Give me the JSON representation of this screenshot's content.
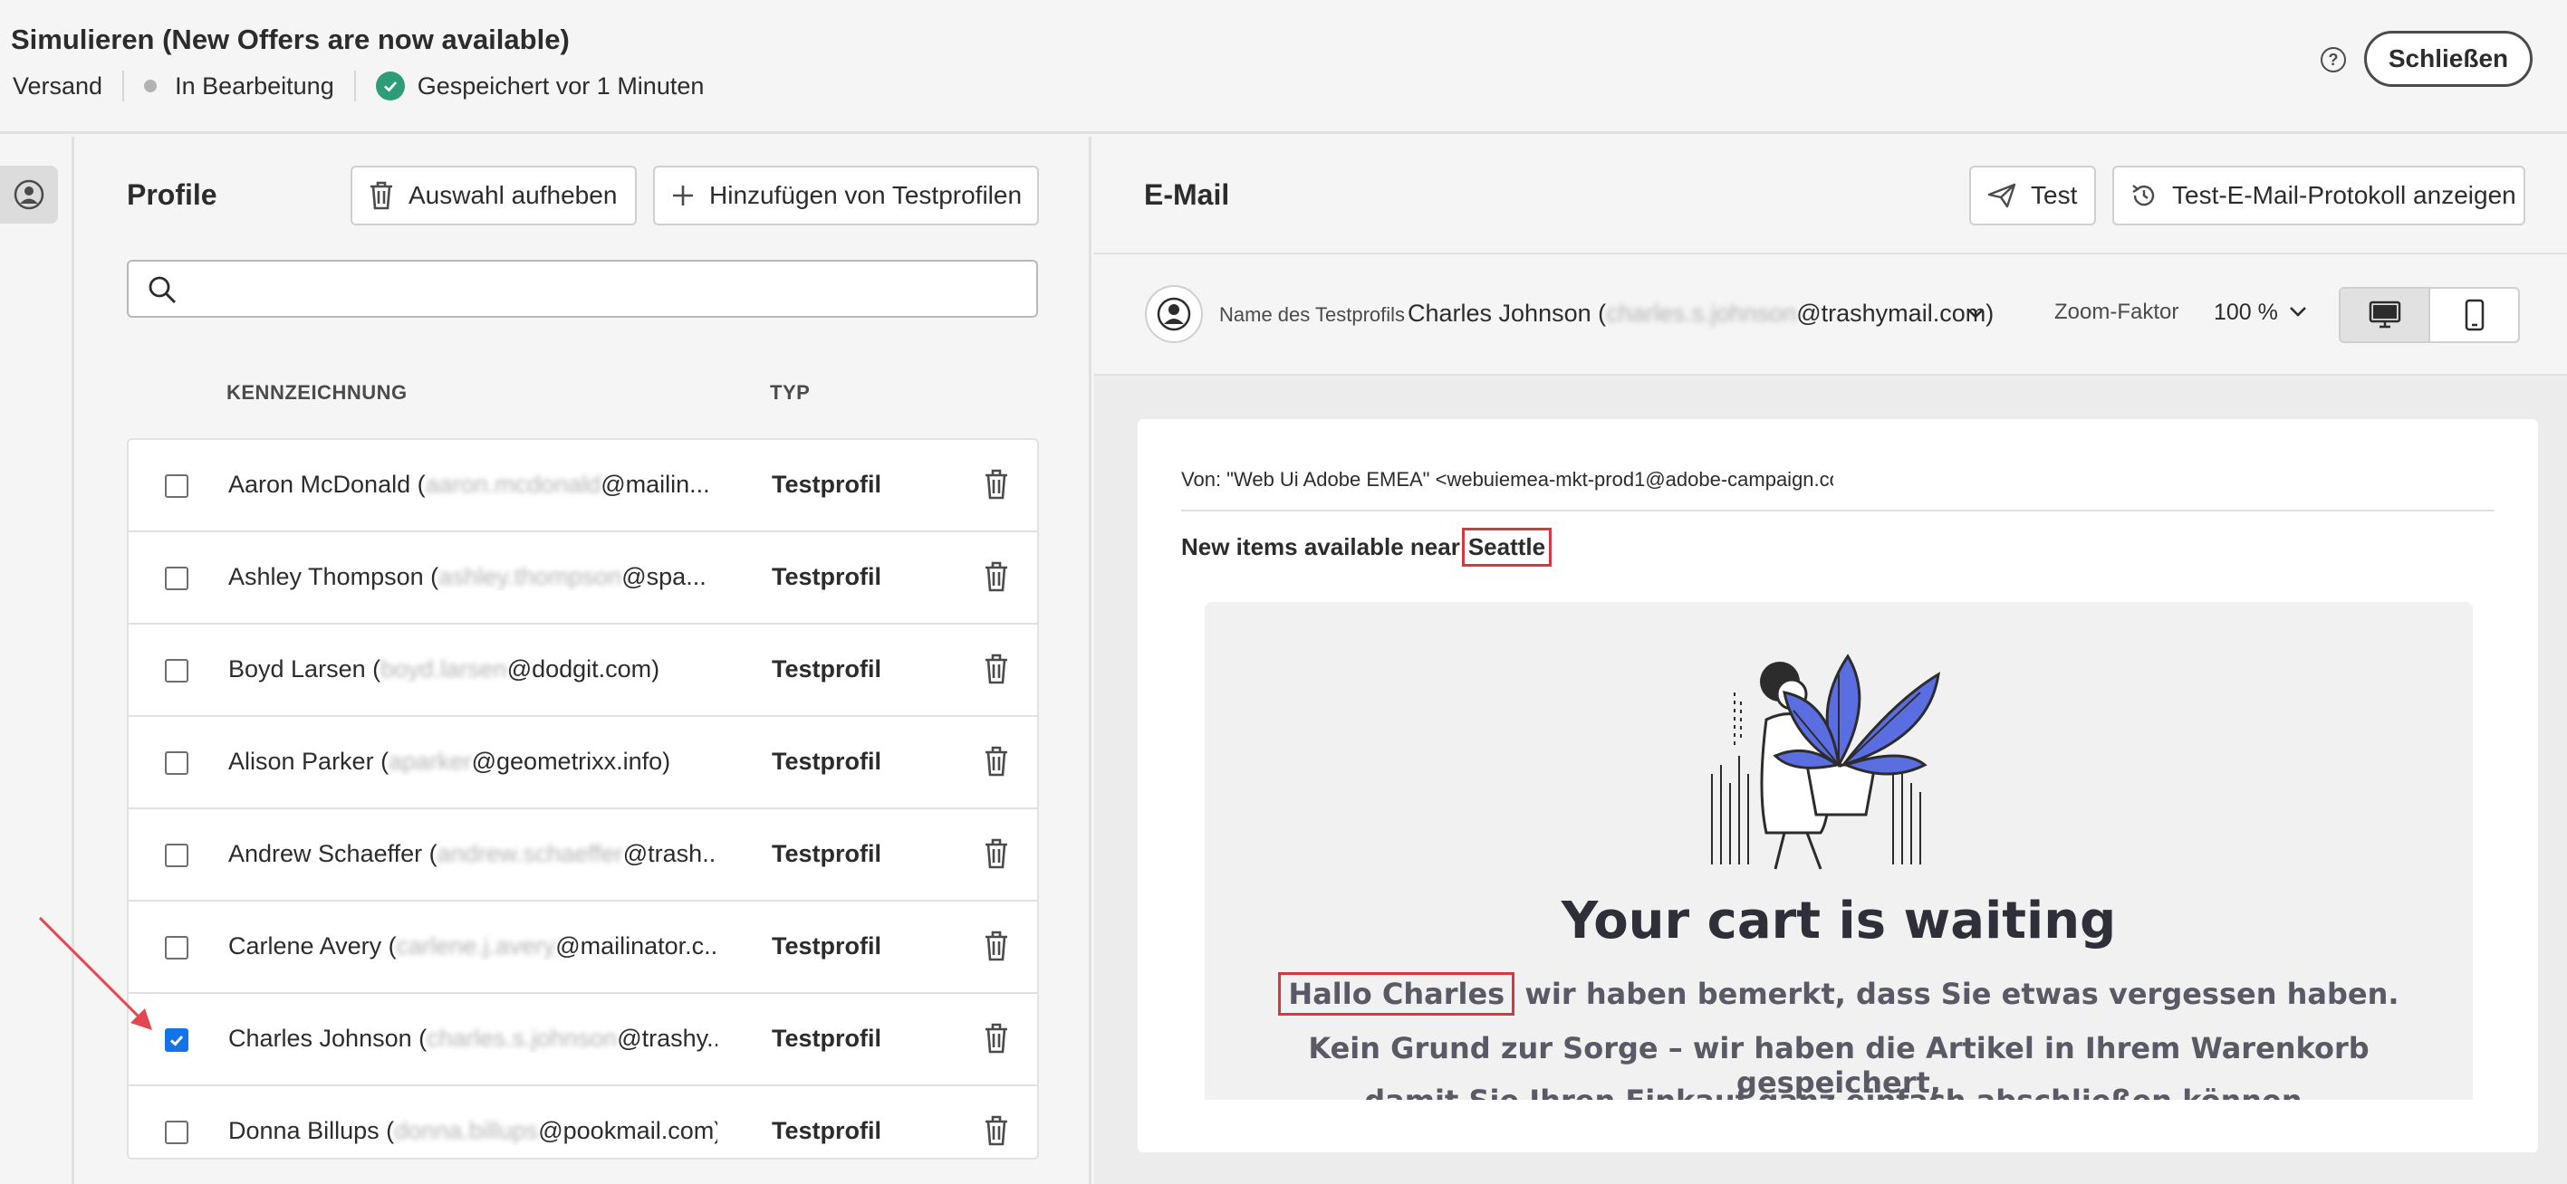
{
  "header": {
    "title": "Simulieren (New Offers are now available)",
    "breadcrumb_delivery": "Versand",
    "status": "In Bearbeitung",
    "saved": "Gespeichert vor 1 Minuten",
    "close_label": "Schließen",
    "help_glyph": "?"
  },
  "profiles": {
    "title": "Profile",
    "clear_selection_label": "Auswahl aufheben",
    "add_test_profiles_label": "Hinzufügen von Testprofilen",
    "search_placeholder": "",
    "col_label": "KENNZEICHNUNG",
    "col_type": "TYP",
    "rows": [
      {
        "name_start": "Aaron McDonald (",
        "name_blur": "aaron.mcdonald",
        "name_end": "@mailin...",
        "type": "Testprofil",
        "checked": false
      },
      {
        "name_start": "Ashley Thompson (",
        "name_blur": "ashley.thompson",
        "name_end": "@spa...",
        "type": "Testprofil",
        "checked": false
      },
      {
        "name_start": "Boyd Larsen (",
        "name_blur": "boyd.larsen",
        "name_end": "@dodgit.com)",
        "type": "Testprofil",
        "checked": false
      },
      {
        "name_start": "Alison Parker (",
        "name_blur": "aparker",
        "name_end": "@geometrixx.info)",
        "type": "Testprofil",
        "checked": false
      },
      {
        "name_start": "Andrew Schaeffer (",
        "name_blur": "andrew.schaeffer",
        "name_end": "@trash...",
        "type": "Testprofil",
        "checked": false
      },
      {
        "name_start": "Carlene Avery (",
        "name_blur": "carlene.j.avery",
        "name_end": "@mailinator.c...",
        "type": "Testprofil",
        "checked": false
      },
      {
        "name_start": "Charles Johnson (",
        "name_blur": "charles.s.johnson",
        "name_end": "@trashy...",
        "type": "Testprofil",
        "checked": true
      },
      {
        "name_start": "Donna Billups (",
        "name_blur": "donna.billups",
        "name_end": "@pookmail.com)",
        "type": "Testprofil",
        "checked": false
      }
    ]
  },
  "email": {
    "title": "E-Mail",
    "test_label": "Test",
    "log_label": "Test-E-Mail-Protokoll anzeigen",
    "profile_label": "Name des Testprofils",
    "profile_value_start": "Charles Johnson (",
    "profile_value_blur": "charles.s.johnson",
    "profile_value_end": "@trashymail.com)",
    "zoom_label": "Zoom-Faktor",
    "zoom_value": "100 %",
    "from_label": "Von",
    "from_value": ": \"Web Ui Adobe EMEA\" <webuiemea-mkt-prod1@adobe-campaign.co",
    "subject_text": "New items available near",
    "subject_city": "Seattle",
    "hero_title": "Your cart is waiting",
    "greeting": "Hallo Charles",
    "line1_rest": " wir haben bemerkt, dass Sie etwas vergessen haben.",
    "line2": "Kein Grund zur Sorge – wir haben die Artikel in Ihrem Warenkorb gespeichert,",
    "line3": "damit Sie Ihren Einkauf ganz einfach abschließen können."
  },
  "colors": {
    "accent": "#1473e6",
    "success": "#2d9d78",
    "highlight": "#d7373f",
    "plant": "#5b6ee1"
  }
}
